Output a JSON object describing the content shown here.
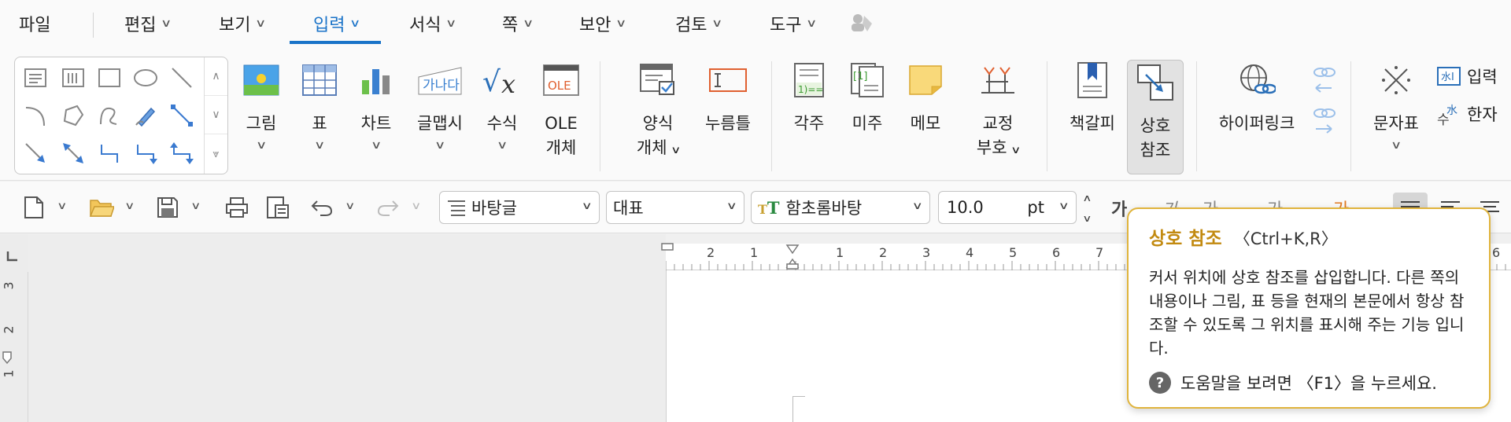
{
  "menu": {
    "file": "파일",
    "edit": "편집",
    "view": "보기",
    "insert": "입력",
    "format": "서식",
    "page": "쪽",
    "security": "보안",
    "review": "검토",
    "tools": "도구"
  },
  "ribbon": {
    "picture": "그림",
    "table": "표",
    "chart": "차트",
    "wordart": "글맵시",
    "equation": "수식",
    "ole_line1": "OLE",
    "ole_line2": "개체",
    "form_object": "양식",
    "form_object_line2": "개체",
    "click_here": "누름틀",
    "footnote": "각주",
    "endnote": "미주",
    "memo": "메모",
    "proof_line1": "교정",
    "proof_line2": "부호",
    "bookmark": "책갈피",
    "crossref_line1": "상호",
    "crossref_line2": "참조",
    "hyperlink": "하이퍼링크",
    "charmap": "문자표",
    "input_truncated": "입력",
    "hanja_truncated": "한자"
  },
  "toolbar": {
    "para_style": "바탕글",
    "lang": "대표",
    "font": "함초롬바탕",
    "font_size": "10.0",
    "unit": "pt",
    "font_icon_text": "T",
    "bold_glyph": "가",
    "italic_glyph": "가",
    "underline_glyph": "가",
    "strike_glyph": "가",
    "color_glyph": "가"
  },
  "ruler": {
    "h_numbers": [
      "2",
      "1",
      "1",
      "2",
      "3",
      "4",
      "5",
      "6",
      "7",
      "6"
    ],
    "v_numbers": [
      "3",
      "2",
      "1"
    ]
  },
  "tooltip": {
    "title": "상호 참조",
    "shortcut": "〈Ctrl+K,R〉",
    "body": "커서 위치에 상호 참조를 삽입합니다. 다른 쪽의 내용이나 그림, 표 등을 현재의 본문에서 항상 참조할 수 있도록 그 위치를 표시해 주는 기능 입니다.",
    "help": "도움말을 보려면 〈F1〉을 누르세요.",
    "help_icon": "?"
  },
  "colors": {
    "accent": "#1a73c8",
    "tooltip_border": "#e0b43c",
    "tooltip_title": "#c28a10"
  }
}
